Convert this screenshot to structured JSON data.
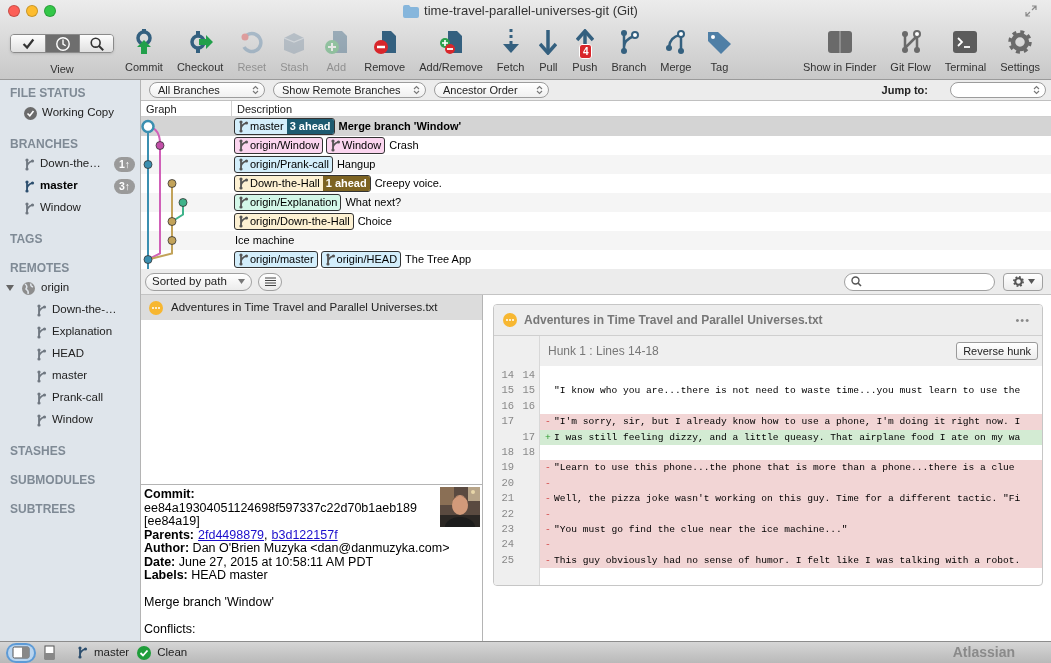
{
  "window": {
    "title": "time-travel-parallel-universes-git (Git)"
  },
  "view": {
    "label": "View",
    "segments": [
      {
        "kind": "check",
        "selected": false
      },
      {
        "kind": "history",
        "selected": true
      },
      {
        "kind": "search",
        "selected": false
      }
    ]
  },
  "actions": [
    {
      "kind": "commit",
      "label": "Commit",
      "disabled": false
    },
    {
      "kind": "checkout",
      "label": "Checkout",
      "disabled": false
    },
    {
      "kind": "reset",
      "label": "Reset",
      "disabled": true
    },
    {
      "kind": "stash",
      "label": "Stash",
      "disabled": true
    },
    {
      "kind": "add",
      "label": "Add",
      "disabled": true
    },
    {
      "kind": "remove",
      "label": "Remove",
      "disabled": false
    },
    {
      "kind": "addremove",
      "label": "Add/Remove",
      "disabled": false
    },
    {
      "kind": "fetch",
      "label": "Fetch",
      "disabled": false
    },
    {
      "kind": "pull",
      "label": "Pull",
      "disabled": false
    },
    {
      "kind": "push",
      "label": "Push",
      "disabled": false,
      "badge": "4"
    },
    {
      "kind": "branch",
      "label": "Branch",
      "disabled": false
    },
    {
      "kind": "merge",
      "label": "Merge",
      "disabled": false
    },
    {
      "kind": "tag",
      "label": "Tag",
      "disabled": false
    }
  ],
  "tools": [
    {
      "kind": "finder",
      "label": "Show in Finder"
    },
    {
      "kind": "gitflow",
      "label": "Git Flow"
    },
    {
      "kind": "terminal",
      "label": "Terminal"
    },
    {
      "kind": "settings",
      "label": "Settings"
    }
  ],
  "sidebar": {
    "sections": [
      {
        "title": "FILE STATUS",
        "items": [
          {
            "kind": "status",
            "label": "Working Copy"
          }
        ]
      },
      {
        "title": "BRANCHES",
        "items": [
          {
            "kind": "branch",
            "label": "Down-the…",
            "current": false,
            "badge": "1↑"
          },
          {
            "kind": "branch",
            "label": "master",
            "current": true,
            "badge": "3↑"
          },
          {
            "kind": "branch",
            "label": "Window",
            "current": false
          }
        ]
      },
      {
        "title": "TAGS"
      },
      {
        "title": "REMOTES",
        "items": [
          {
            "kind": "remote",
            "label": "origin",
            "expanded": true,
            "children": [
              {
                "kind": "branch",
                "label": "Down-the-…",
                "current": false
              },
              {
                "kind": "branch",
                "label": "Explanation",
                "current": false
              },
              {
                "kind": "branch",
                "label": "HEAD",
                "current": false
              },
              {
                "kind": "branch",
                "label": "master",
                "current": false
              },
              {
                "kind": "branch",
                "label": "Prank-call",
                "current": false
              },
              {
                "kind": "branch",
                "label": "Window",
                "current": false
              }
            ]
          }
        ]
      },
      {
        "title": "STASHES"
      },
      {
        "title": "SUBMODULES"
      },
      {
        "title": "SUBTREES"
      }
    ]
  },
  "filters": {
    "dropdowns": [
      "All Branches",
      "Show Remote Branches",
      "Ancestor Order"
    ],
    "jump_label": "Jump to:"
  },
  "history": {
    "columns": [
      "Graph",
      "Description"
    ],
    "commits": [
      {
        "selected": true,
        "labels": [
          {
            "text": "master",
            "color": "#d3eefb",
            "ahead": {
              "text": "3 ahead",
              "color": "#1d5a70"
            }
          }
        ],
        "message": "Merge branch 'Window'"
      },
      {
        "selected": false,
        "labels": [
          {
            "text": "origin/Window",
            "color": "#fbd5ef"
          },
          {
            "text": "Window",
            "color": "#fbd5ef"
          }
        ],
        "message": "Crash"
      },
      {
        "selected": false,
        "labels": [
          {
            "text": "origin/Prank-call",
            "color": "#d3eefb"
          }
        ],
        "message": "Hangup"
      },
      {
        "selected": false,
        "labels": [
          {
            "text": "Down-the-Hall",
            "color": "#fdf1d3",
            "ahead": {
              "text": "1 ahead",
              "color": "#7d6322"
            }
          }
        ],
        "message": "Creepy voice."
      },
      {
        "selected": false,
        "labels": [
          {
            "text": "origin/Explanation",
            "color": "#d3f7e8"
          }
        ],
        "message": "What next?"
      },
      {
        "selected": false,
        "labels": [
          {
            "text": "origin/Down-the-Hall",
            "color": "#fdf1d3"
          }
        ],
        "message": "Choice"
      },
      {
        "selected": false,
        "message": "Ice machine"
      },
      {
        "selected": false,
        "labels": [
          {
            "text": "origin/master",
            "color": "#d3eefb"
          },
          {
            "text": "origin/HEAD",
            "color": "#d3eefb"
          }
        ],
        "message": "The Tree App"
      }
    ]
  },
  "files": {
    "sort": "Sorted by path",
    "items": [
      {
        "kind": "modified",
        "name": "Adventures in Time Travel and Parallel Universes.txt",
        "selected": true
      }
    ]
  },
  "details": {
    "commit_label": "Commit:",
    "hash": "ee84a19304051124698f597337c22d70b1aeb189",
    "short_hash": "[ee84a19]",
    "parents": {
      "label": "Parents:",
      "links": [
        "2fd4498879",
        "b3d122157f"
      ],
      "separator": ","
    },
    "fields": [
      {
        "label": "Author:",
        "value": "Dan O'Brien Muzyka <dan@danmuzyka.com>"
      },
      {
        "label": "Date:",
        "value": "June 27, 2015 at 10:58:11 AM PDT"
      },
      {
        "label": "Labels:",
        "value": "HEAD master"
      }
    ],
    "message": "Merge branch 'Window'",
    "conflicts_label": "Conflicts:"
  },
  "diff": {
    "file": {
      "kind": "modified",
      "name": "Adventures in Time Travel and Parallel Universes.txt"
    },
    "more": "•••",
    "hunk": {
      "title": "Hunk 1 : Lines 14-18",
      "button": "Reverse hunk"
    },
    "lines": [
      {
        "kind": "context",
        "old": "14",
        "new": "14"
      },
      {
        "kind": "context",
        "old": "15",
        "new": "15",
        "text": "\"I know who you are...there is not need to waste time...you must learn to use the"
      },
      {
        "kind": "context",
        "old": "16",
        "new": "16"
      },
      {
        "kind": "removed",
        "old": "17",
        "sign": "-",
        "text": "\"I'm sorry, sir, but I already know how to use a phone, I'm doing it right now. I"
      },
      {
        "kind": "added",
        "new": "17",
        "sign": "+",
        "text": "I was still feeling dizzy, and a little queasy. That airplane food I ate on my wa"
      },
      {
        "kind": "context",
        "old": "18",
        "new": "18"
      },
      {
        "kind": "removed",
        "old": "19",
        "sign": "-",
        "text": "\"Learn to use this phone...the phone that is more than a phone...there is a clue"
      },
      {
        "kind": "removed",
        "old": "20",
        "sign": "-"
      },
      {
        "kind": "removed",
        "old": "21",
        "sign": "-",
        "text": "Well, the pizza joke wasn't working on this guy. Time for a different tactic. \"Fi"
      },
      {
        "kind": "removed",
        "old": "22",
        "sign": "-"
      },
      {
        "kind": "removed",
        "old": "23",
        "sign": "-",
        "text": "\"You must go find the clue near the ice machine...\""
      },
      {
        "kind": "removed",
        "old": "24",
        "sign": "-"
      },
      {
        "kind": "removed",
        "old": "25",
        "sign": "-",
        "text": "This guy obviously had no sense of humor. I felt like I was talking with a robot."
      }
    ]
  },
  "status_bar": {
    "layout_buttons": [
      {
        "kind": "sidebar",
        "selected": true
      },
      {
        "kind": "bottom",
        "selected": false
      }
    ],
    "branch": "master",
    "state": "Clean",
    "brand": "Atlassian"
  }
}
